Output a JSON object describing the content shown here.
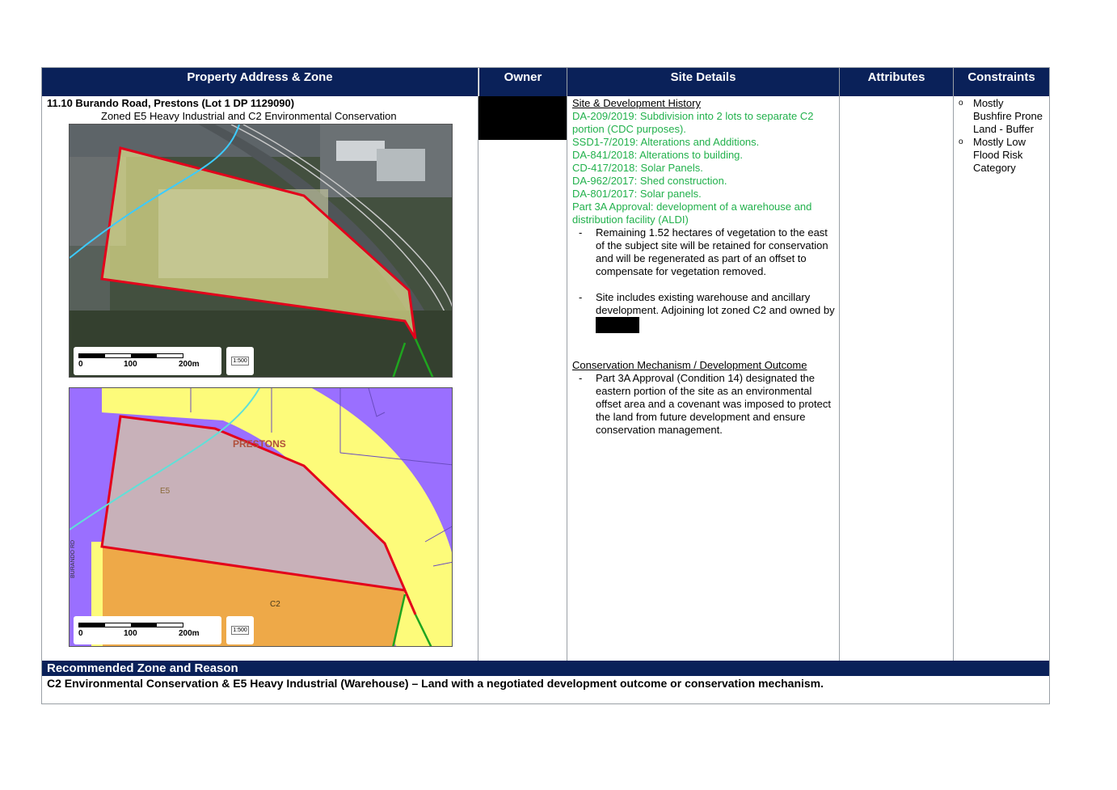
{
  "headers": {
    "address": "Property Address & Zone",
    "owner": "Owner",
    "site": "Site Details",
    "attributes": "Attributes",
    "constraints": "Constraints"
  },
  "property": {
    "address": "11.10 Burando Road, Prestons (Lot 1 DP 1129090)",
    "zoned": "Zoned E5 Heavy Industrial and C2 Environmental Conservation"
  },
  "map1": {
    "scale_0": "0",
    "scale_100": "100",
    "scale_200": "200m",
    "scale_badge": "1:500"
  },
  "map2": {
    "scale_0": "0",
    "scale_100": "100",
    "scale_200": "200m",
    "scale_badge": "1:500",
    "suburb": "PRESTONS",
    "zone_e5": "E5",
    "zone_c2": "C2",
    "road": "BURANDO RD"
  },
  "site_details": {
    "history_heading": "Site & Development History",
    "history": [
      "DA-209/2019: Subdivision into 2 lots to separate C2 portion (CDC purposes).",
      "SSD1-7/2019: Alterations and Additions.",
      "DA-841/2018: Alterations to building.",
      "CD-417/2018: Solar Panels.",
      "DA-962/2017: Shed construction.",
      "DA-801/2017: Solar panels.",
      "Part 3A Approval:  development of a warehouse and distribution facility (ALDI)"
    ],
    "bullet1": "Remaining 1.52 hectares of vegetation to the east of the subject site will be retained for conservation and will be regenerated as part of an offset to compensate for vegetation removed.",
    "bullet2": "Site includes existing warehouse and ancillary development. Adjoining lot zoned C2 and owned by",
    "conservation_heading": "Conservation Mechanism / Development Outcome",
    "bullet3": "Part 3A Approval (Condition 14) designated the eastern portion of the site as an environmental offset area and a covenant was imposed to protect the land from future development and ensure conservation management.",
    "dash": "-"
  },
  "constraints": [
    "Mostly Bushfire Prone Land - Buffer",
    "Mostly Low Flood Risk Category"
  ],
  "bullet_glyph": "o",
  "recommendation": {
    "heading": "Recommended Zone and Reason",
    "text": "C2 Environmental Conservation & E5 Heavy Industrial (Warehouse) – Land with a negotiated development outcome or conservation mechanism."
  },
  "colors": {
    "header_bg": "#0a2159",
    "history_text": "#22b14c",
    "boundary": "#e3001b",
    "e5_fill": "#c8b1b9",
    "c2_fill": "#eea948",
    "industrial_purple": "#9a6fff",
    "road_yellow": "#fdfb7a"
  }
}
